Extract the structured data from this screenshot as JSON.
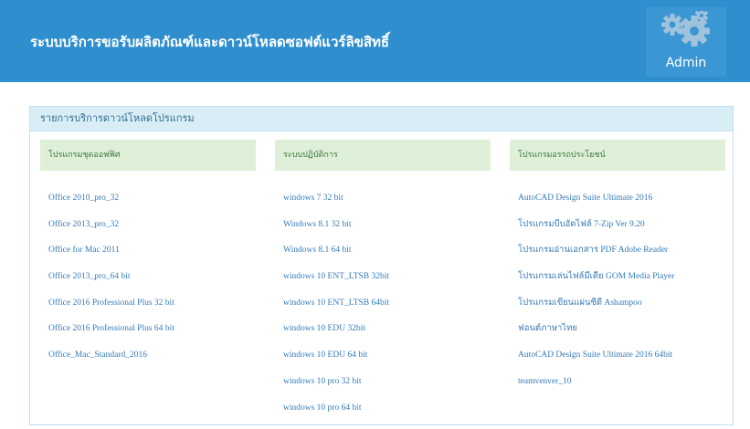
{
  "header": {
    "title": "ระบบบริการขอรับผลิตภัณฑ์และดาวน์โหลดซอฟต์แวร์ลิขสิทธิ์",
    "admin_label": "Admin",
    "icon": "gears-icon"
  },
  "panel": {
    "title": "รายการบริการดาวน์โหลดโปรแกรม"
  },
  "columns": [
    {
      "header": "โปรแกรมชุดออฟฟิศ",
      "items": [
        "Office 2010_pro_32",
        "Office 2013_pro_32",
        "Office for Mac 2011",
        "Office 2013_pro_64 bit",
        "Office 2016 Professional Plus 32 bit",
        "Office 2016 Professional Plus 64 bit",
        "Office_Mac_Standard_2016"
      ]
    },
    {
      "header": "ระบบปฏิบัติการ",
      "items": [
        "windows 7 32 bit",
        "Windows 8.1 32 bit",
        "Windows 8.1 64 bit",
        "windows 10 ENT_LTSB 32bit",
        "windows 10 ENT_LTSB 64bit",
        "windows 10 EDU 32bit",
        "windows 10 EDU 64 bit",
        "windows 10 pro 32 bit",
        "windows 10 pro 64 bit"
      ]
    },
    {
      "header": "โปรแกรมอรรถประโยชน์",
      "items": [
        "AutoCAD Design Suite Ultimate 2016",
        "โปรแกรมบีบอัดไฟล์ 7-Zip Ver 9.20",
        "โปรแกรมอ่านเอกสาร PDF Adobe Reader",
        "โปรแกรมเล่นไฟล์มีเดีย GOM Media Player",
        "โปรแกรมเขียนแผ่นซีดี Ashampoo",
        "ฟอนต์ภาษาไทย",
        "AutoCAD Design Suite Ultimate 2016 64bit",
        "teamvenver_10"
      ]
    }
  ],
  "colors": {
    "header_bg": "#2f8fce",
    "panel_heading_bg": "#d9edf7",
    "column_header_bg": "#dff0d8",
    "link": "#337ab7"
  }
}
